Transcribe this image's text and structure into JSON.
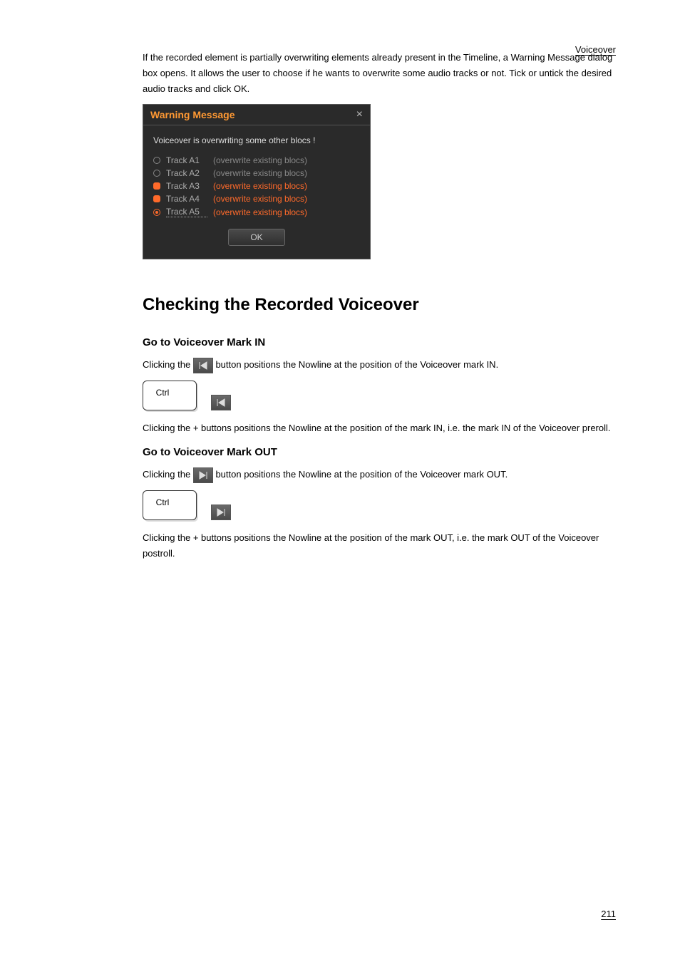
{
  "header": {
    "right": "Voiceover"
  },
  "intro": "If the recorded element is partially overwriting elements already present in the Timeline, a Warning Message dialog box opens. It allows the user to choose if he wants to overwrite some audio tracks or not. Tick or untick the desired audio tracks and click OK.",
  "dialog": {
    "title": "Warning Message",
    "message": "Voiceover is overwriting some other blocs !",
    "tracks": [
      {
        "label": "Track A1",
        "note": "(overwrite existing blocs)",
        "orange": false,
        "bullet": "gray"
      },
      {
        "label": "Track A2",
        "note": "(overwrite existing blocs)",
        "orange": false,
        "bullet": "gray"
      },
      {
        "label": "Track A3",
        "note": "(overwrite existing blocs)",
        "orange": true,
        "bullet": "rounded"
      },
      {
        "label": "Track A4",
        "note": "(overwrite existing blocs)",
        "orange": true,
        "bullet": "rounded"
      },
      {
        "label": "Track A5",
        "note": "(overwrite existing blocs)",
        "orange": true,
        "bullet": "selected",
        "dotted": true
      }
    ],
    "ok": "OK"
  },
  "section": {
    "title": "Checking the Recorded Voiceover"
  },
  "markIn": {
    "title": "Go to Voiceover Mark IN",
    "line1_before": "Clicking the",
    "line1_after": "button positions the Nowline at the position of the Voiceover mark IN.",
    "ctrl_label": "Ctrl",
    "line2_before": "Clicking the",
    "line2_mid": "+",
    "line2_after": "buttons positions the Nowline at the position of the mark IN, i.e. the mark IN of the Voiceover preroll."
  },
  "markOut": {
    "title": "Go to Voiceover Mark OUT",
    "line1_before": "Clicking the",
    "line1_after": "button positions the Nowline at the position of the Voiceover mark OUT.",
    "ctrl_label": "Ctrl",
    "line2_before": "Clicking the",
    "line2_mid": "+",
    "line2_after": "buttons positions the Nowline at the position of the mark OUT, i.e. the mark OUT of the Voiceover postroll."
  },
  "footer": {
    "right": "211"
  }
}
